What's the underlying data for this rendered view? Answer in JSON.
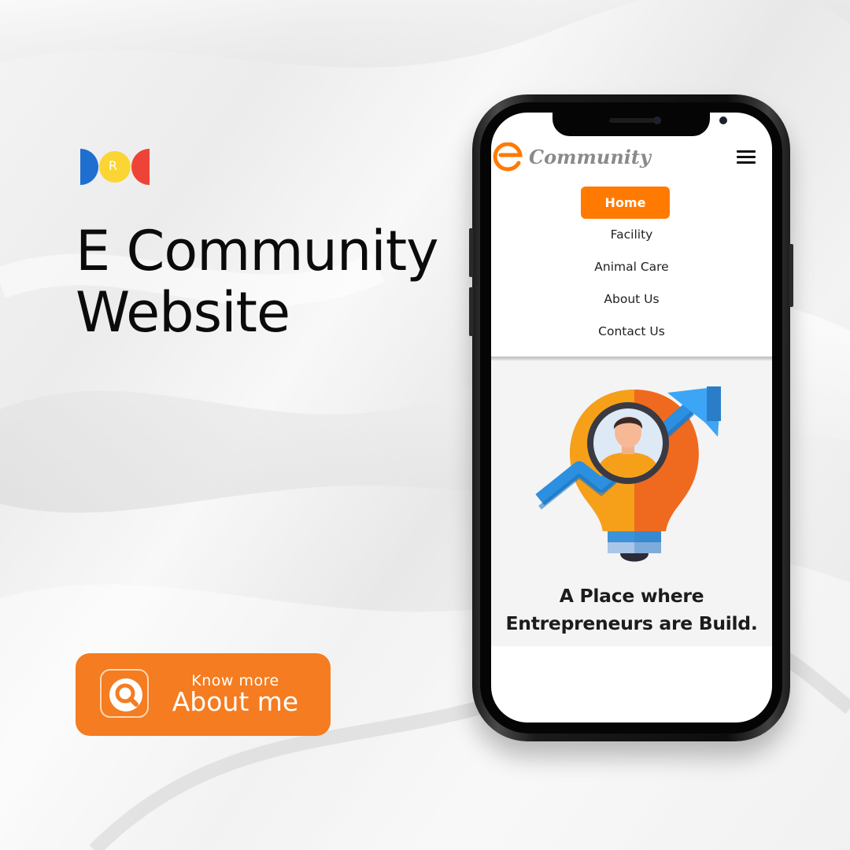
{
  "headline": {
    "line1": "E Community",
    "line2": "Website"
  },
  "brand_logo": {
    "letter": "R",
    "colors": [
      "#1e6fd0",
      "#fbd534",
      "#ee4437"
    ]
  },
  "cta": {
    "small_label": "Know more",
    "big_label": "About me",
    "icon": "search-icon",
    "color": "#f57c20"
  },
  "phone": {
    "site": {
      "name": "Community",
      "logo_letter": "e",
      "accent": "#ff7a00"
    },
    "nav": {
      "items": [
        {
          "label": "Home",
          "active": true
        },
        {
          "label": "Facility",
          "active": false
        },
        {
          "label": "Animal Care",
          "active": false
        },
        {
          "label": "About Us",
          "active": false
        },
        {
          "label": "Contact Us",
          "active": false
        }
      ],
      "menu_icon": "hamburger-menu-icon"
    },
    "hero": {
      "illustration": "lightbulb-person-growth-icon",
      "line1": "A Place where",
      "line2": "Entrepreneurs are Build."
    }
  }
}
